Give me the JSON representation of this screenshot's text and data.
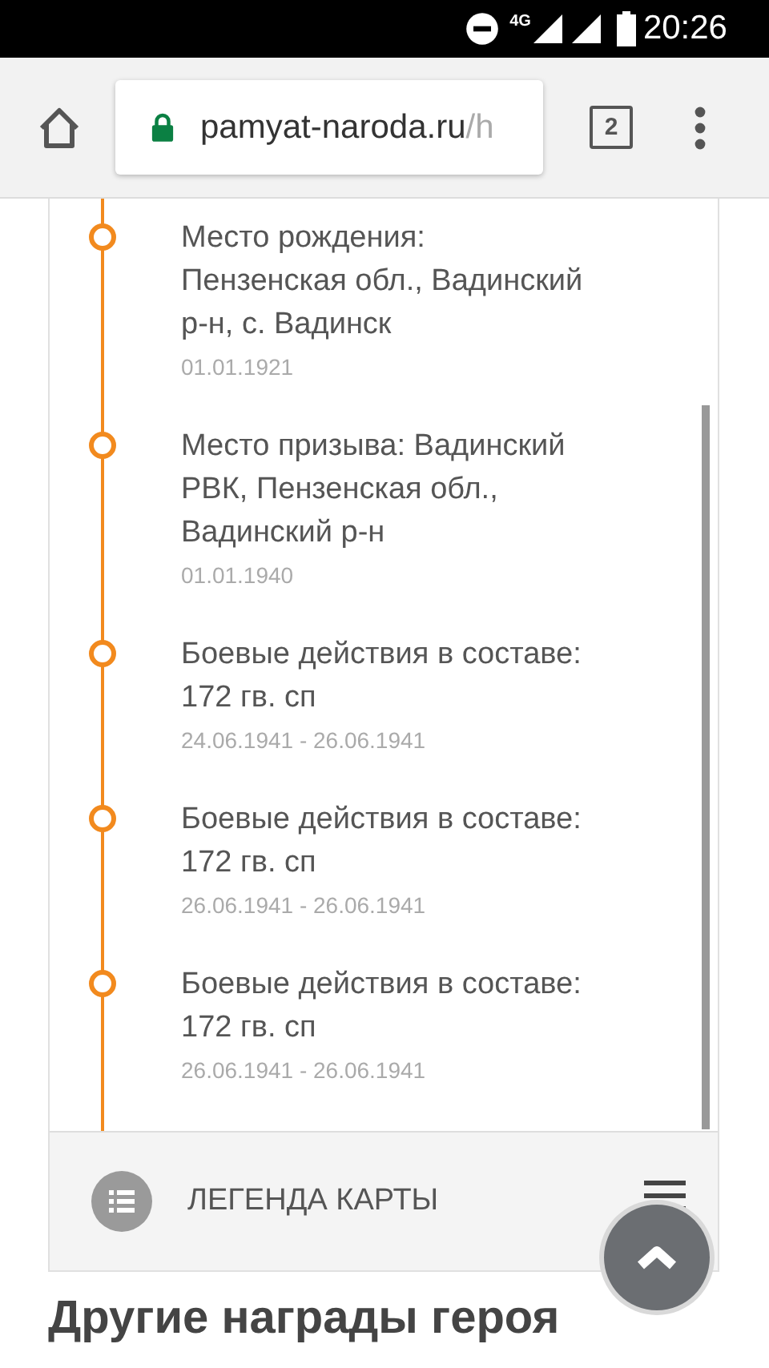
{
  "status_bar": {
    "network": "4G",
    "time": "20:26"
  },
  "browser": {
    "url_host": "pamyat-naroda.ru",
    "url_rest": "/h",
    "tab_count": "2"
  },
  "timeline": [
    {
      "title": "Место рождения: Пензенская обл., Вадинский р-н, с. Вадинск",
      "date": "01.01.1921"
    },
    {
      "title": "Место призыва: Вадинский РВК, Пензенская обл., Вадинский р-н",
      "date": "01.01.1940"
    },
    {
      "title": "Боевые действия в составе: 172 гв. сп",
      "date": "24.06.1941 - 26.06.1941"
    },
    {
      "title": "Боевые действия в составе: 172 гв. сп",
      "date": "26.06.1941 - 26.06.1941"
    },
    {
      "title": "Боевые действия в составе: 172 гв. сп",
      "date": "26.06.1941 - 26.06.1941"
    }
  ],
  "legend": {
    "label": "ЛЕГЕНДА КАРТЫ"
  },
  "next_heading": "Другие награды героя"
}
